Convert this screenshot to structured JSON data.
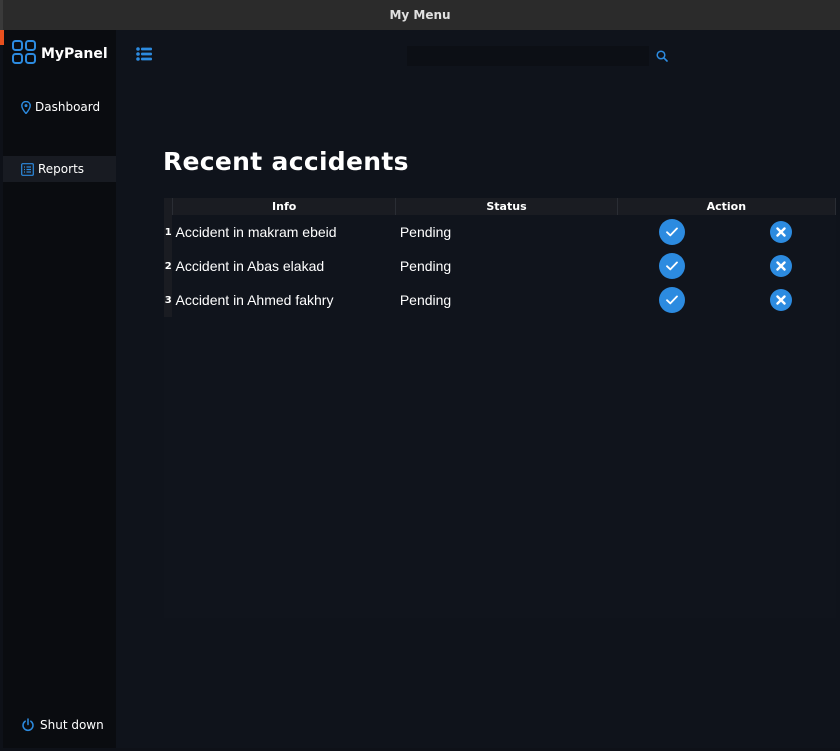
{
  "window": {
    "title": "My Menu"
  },
  "sidebar": {
    "brand": "MyPanel",
    "items": [
      {
        "label": "Dashboard",
        "icon": "map-pin-icon"
      },
      {
        "label": "Reports",
        "icon": "list-icon"
      }
    ],
    "shutdown_label": "Shut down"
  },
  "header": {
    "search": {
      "value": "",
      "placeholder": ""
    }
  },
  "main": {
    "title": "Recent accidents",
    "table": {
      "columns": [
        "Info",
        "Status",
        "Action"
      ],
      "rows": [
        {
          "index": "1",
          "info": "Accident in makram ebeid",
          "status": "Pending"
        },
        {
          "index": "2",
          "info": "Accident in Abas elakad",
          "status": "Pending"
        },
        {
          "index": "3",
          "info": "Accident in Ahmed fakhry",
          "status": "Pending"
        }
      ]
    }
  },
  "colors": {
    "accent": "#2c8be0",
    "background": "#0f131b",
    "sidebar": "#0a0c10",
    "highlight": "#e8501e"
  }
}
